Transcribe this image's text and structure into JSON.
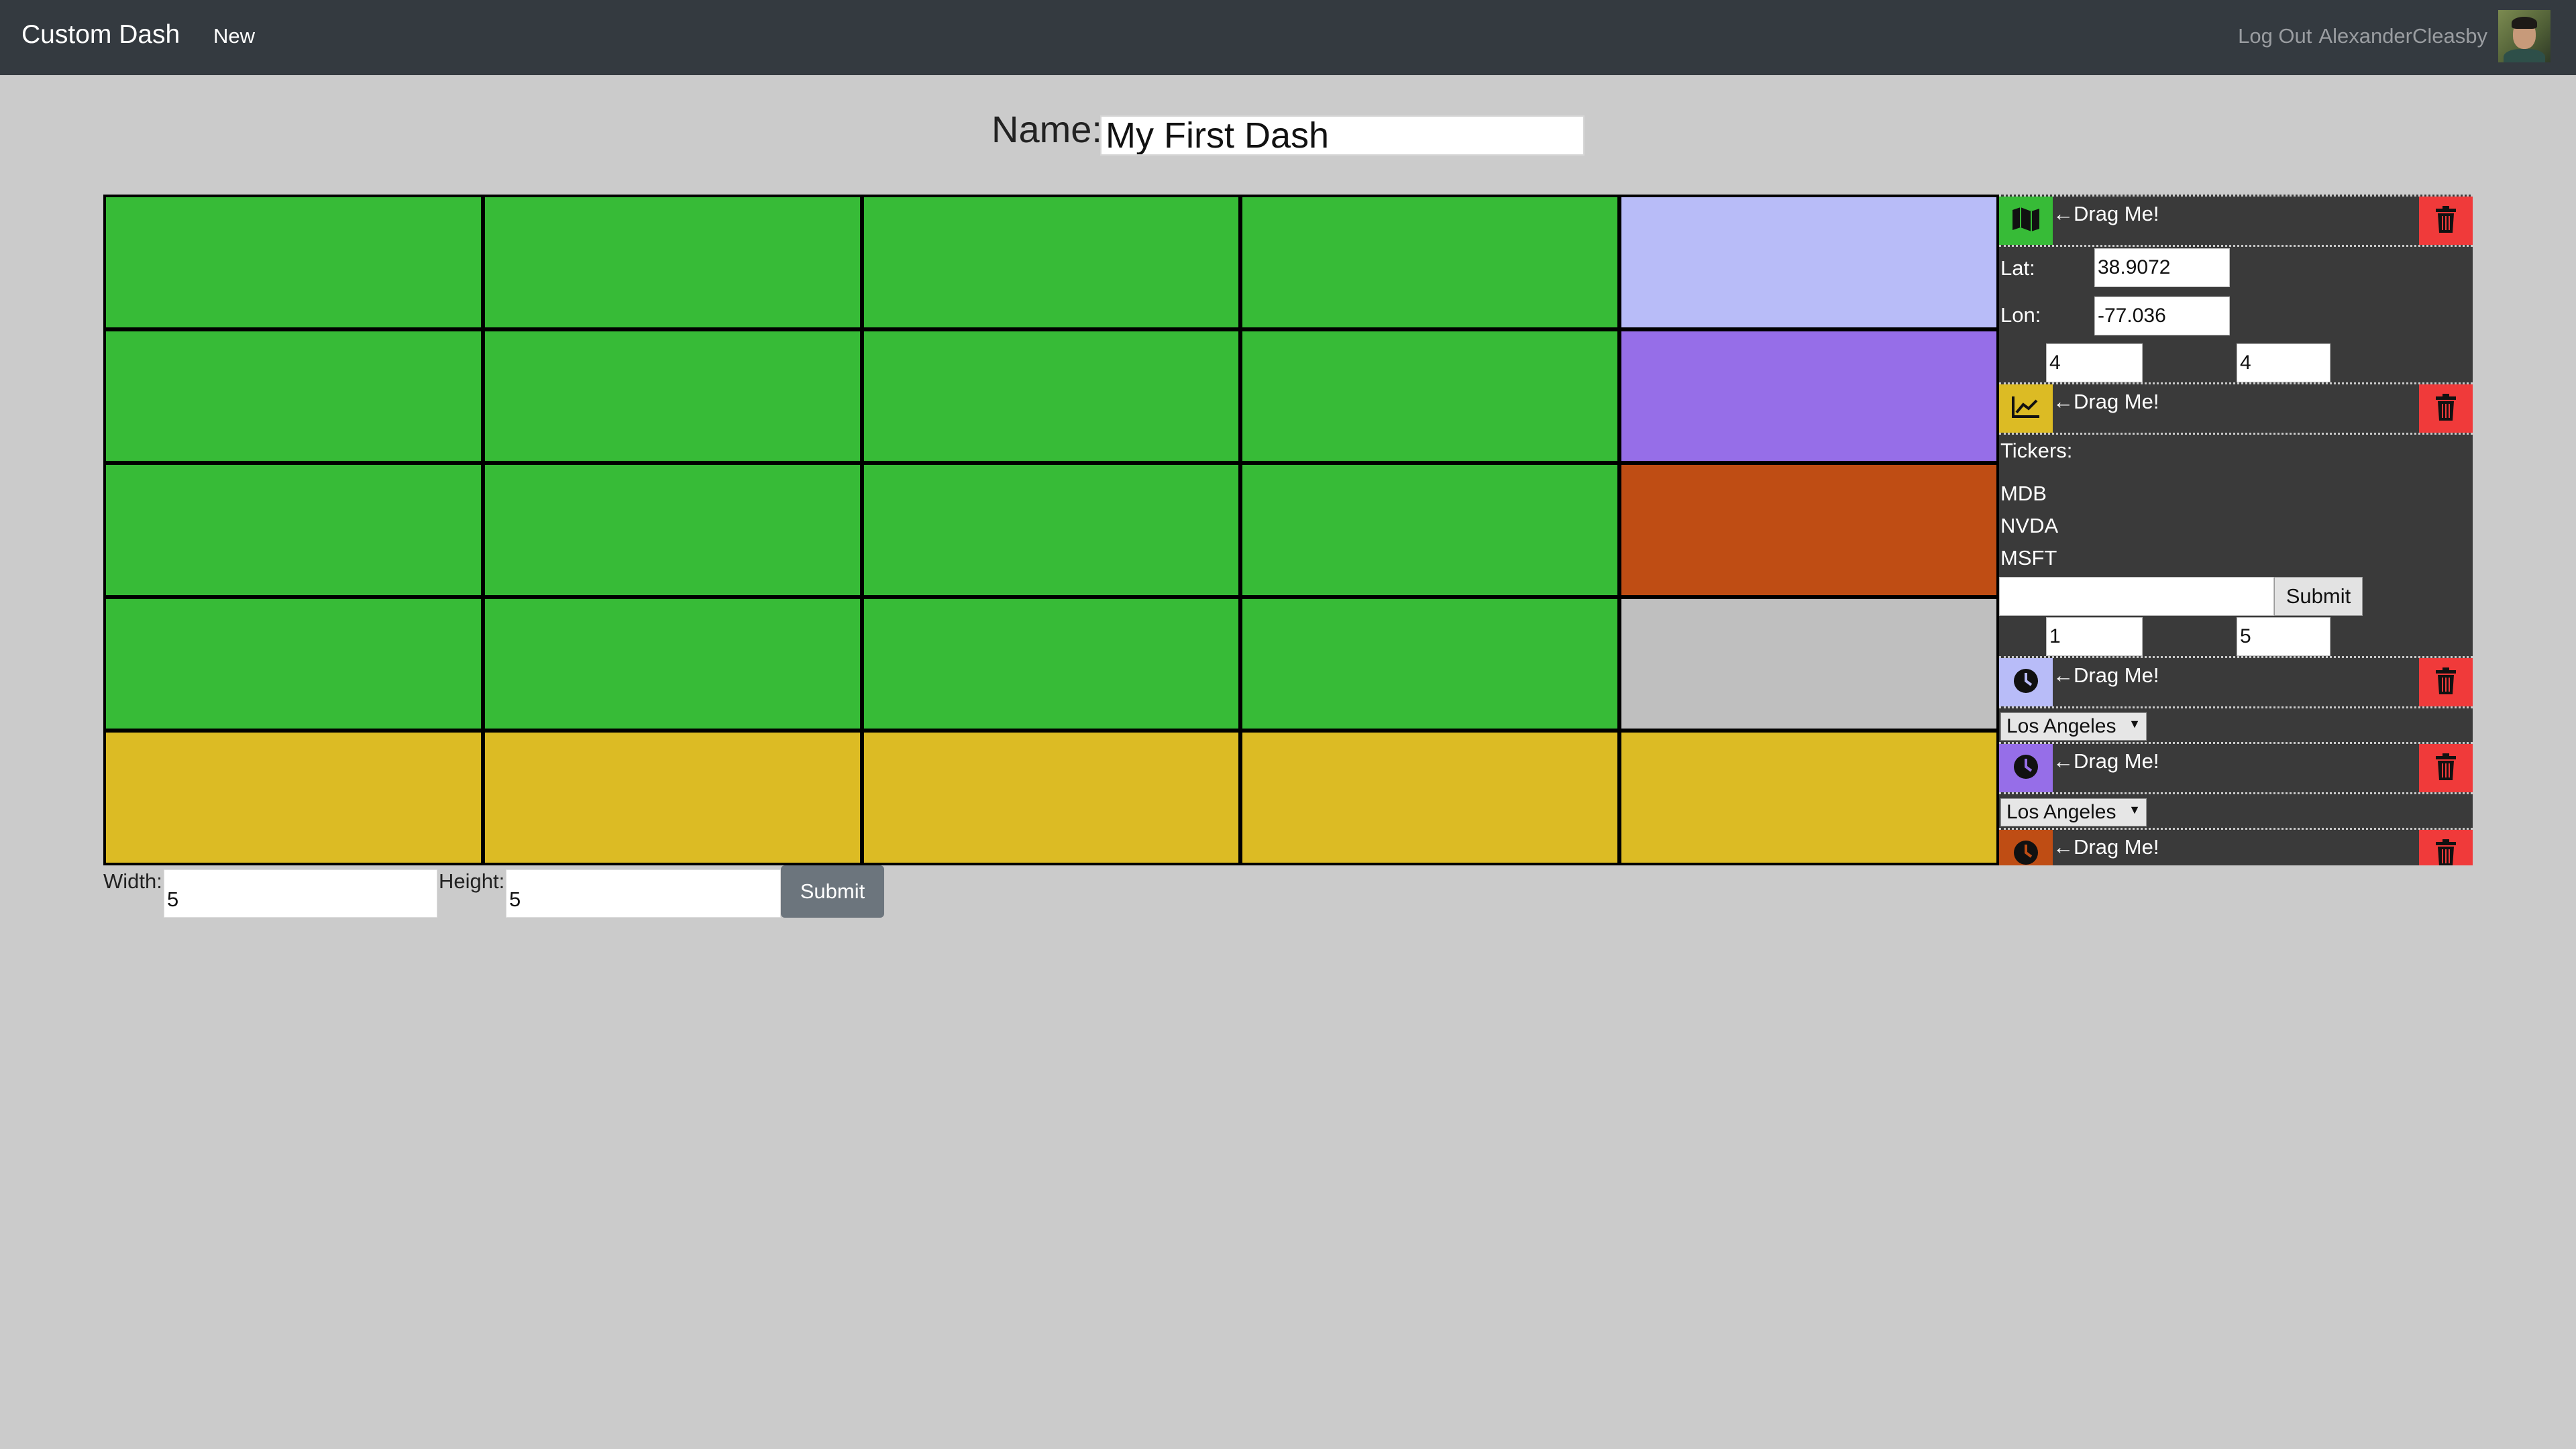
{
  "navbar": {
    "brand": "Custom Dash",
    "new_label": "New",
    "logout_label": "Log Out",
    "username": "AlexanderCleasby"
  },
  "dash": {
    "name_label": "Name:",
    "name_value": "My First Dash"
  },
  "grid": {
    "columns": 5,
    "rows": 5,
    "cells": [
      [
        "#37bb37",
        "#37bb37",
        "#37bb37",
        "#37bb37",
        "#b8bcf8"
      ],
      [
        "#37bb37",
        "#37bb37",
        "#37bb37",
        "#37bb37",
        "#966ee8"
      ],
      [
        "#37bb37",
        "#37bb37",
        "#37bb37",
        "#37bb37",
        "#bf4d14"
      ],
      [
        "#37bb37",
        "#37bb37",
        "#37bb37",
        "#37bb37",
        "#bfbfbf"
      ],
      [
        "#dcbb24",
        "#dcbb24",
        "#dcbb24",
        "#dcbb24",
        "#dcbb24"
      ]
    ]
  },
  "controls": {
    "width_label": "Width:",
    "width_value": "5",
    "height_label": "Height:",
    "height_value": "5",
    "submit_label": "Submit"
  },
  "widgets": {
    "drag_label": "Drag Me!",
    "map": {
      "color": "#37bb37",
      "icon": "map-icon",
      "lat_label": "Lat:",
      "lat_value": "38.9072",
      "lon_label": "Lon:",
      "lon_value": "-77.036",
      "width_value": "4",
      "height_value": "4"
    },
    "stocks": {
      "color": "#dcbb24",
      "icon": "chart-line-icon",
      "tickers_label": "Tickers:",
      "tickers": [
        "MDB",
        "NVDA",
        "MSFT"
      ],
      "ticker_input_value": "",
      "submit_label": "Submit",
      "width_value": "1",
      "height_value": "5"
    },
    "clock1": {
      "color": "#b8bcf8",
      "icon": "clock-icon",
      "city": "Los Angeles"
    },
    "clock2": {
      "color": "#966ee8",
      "icon": "clock-icon",
      "city": "Los Angeles"
    },
    "clock3": {
      "color": "#bf4d14",
      "icon": "clock-icon"
    }
  }
}
